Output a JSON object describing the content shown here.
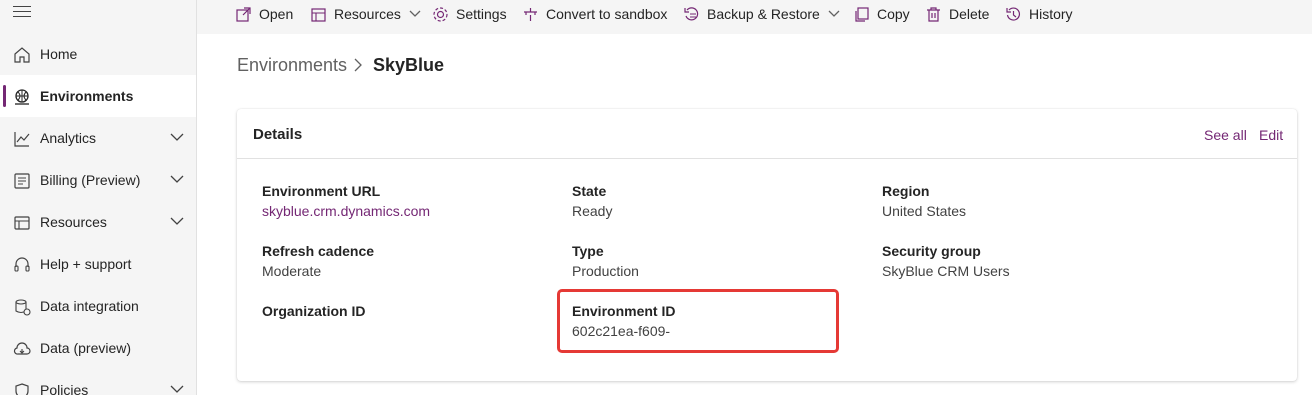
{
  "sidebar": {
    "items": [
      {
        "label": "Home",
        "icon": "home-icon"
      },
      {
        "label": "Environments",
        "icon": "environments-icon",
        "active": true
      },
      {
        "label": "Analytics",
        "icon": "analytics-icon",
        "expandable": true
      },
      {
        "label": "Billing (Preview)",
        "icon": "billing-icon",
        "expandable": true
      },
      {
        "label": "Resources",
        "icon": "resources-icon",
        "expandable": true
      },
      {
        "label": "Help + support",
        "icon": "headset-icon"
      },
      {
        "label": "Data integration",
        "icon": "data-integration-icon"
      },
      {
        "label": "Data (preview)",
        "icon": "data-preview-icon"
      },
      {
        "label": "Policies",
        "icon": "policies-icon",
        "expandable": true
      }
    ]
  },
  "toolbar": {
    "open": "Open",
    "resources": "Resources",
    "settings": "Settings",
    "convert": "Convert to sandbox",
    "backup": "Backup & Restore",
    "copy": "Copy",
    "delete": "Delete",
    "history": "History"
  },
  "breadcrumb": {
    "parent": "Environments",
    "current": "SkyBlue"
  },
  "details": {
    "title": "Details",
    "see_all": "See all",
    "edit": "Edit",
    "fields": {
      "env_url_label": "Environment URL",
      "env_url_value": "skyblue.crm.dynamics.com",
      "state_label": "State",
      "state_value": "Ready",
      "region_label": "Region",
      "region_value": "United States",
      "refresh_label": "Refresh cadence",
      "refresh_value": "Moderate",
      "type_label": "Type",
      "type_value": "Production",
      "security_label": "Security group",
      "security_value": "SkyBlue CRM Users",
      "org_id_label": "Organization ID",
      "env_id_label": "Environment ID",
      "env_id_value": "602c21ea-f609-"
    }
  },
  "colors": {
    "accent": "#742774",
    "highlight": "#e53935",
    "sidebar_bg": "#f5f5f5"
  }
}
